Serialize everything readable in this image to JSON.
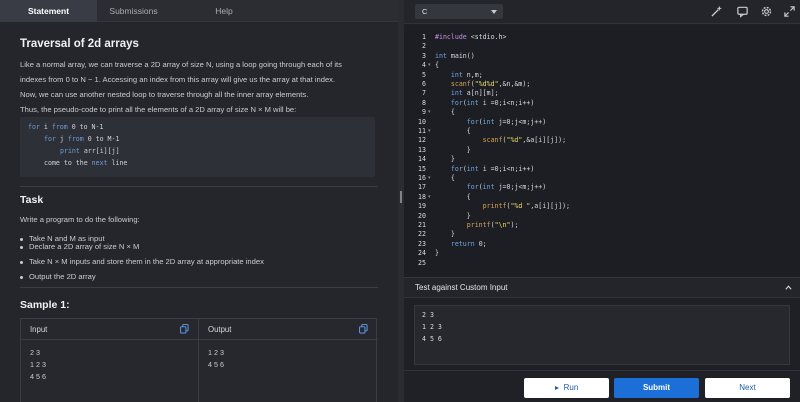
{
  "tabs": {
    "statement": "Statement",
    "submissions": "Submissions",
    "help": "Help"
  },
  "problem": {
    "title": "Traversal of 2d arrays",
    "intro_lines": [
      "Like a normal array, we can traverse a 2D array of size N, using a loop going through each of its",
      "indexes from 0 to N − 1. Accessing an index from this array will give us the array at that index.",
      "Now, we can use another nested loop to traverse through all the inner array elements.",
      "Thus, the pseudo-code to print all the elements of a 2D array of size N × M will be:"
    ],
    "pseudo_code": [
      {
        "kw1": "for",
        "rest1": " i ",
        "kw2": "from",
        "rest2": " 0 to N-1"
      },
      {
        "kw1": "for",
        "rest1": " j ",
        "kw2": "from",
        "rest2": " 0 to M-1"
      },
      {
        "kw1": "print",
        "rest1": " arr[i][j]",
        "kw2": "",
        "rest2": ""
      },
      {
        "kw1": "",
        "rest1": "come to the ",
        "kw2": "next",
        "rest2": " line"
      }
    ],
    "task_heading": "Task",
    "task_intro": "Write a program to do the following:",
    "task_items": [
      "Take N and M as input",
      "Declare a 2D array of size N × M",
      "Take N × M inputs and store them in the 2D array at appropriate index",
      "Output the 2D array"
    ],
    "sample_heading": "Sample 1:",
    "sample": {
      "input_label": "Input",
      "output_label": "Output",
      "input_lines": [
        "2 3",
        "1 2 3",
        "4 5 6"
      ],
      "output_lines": [
        "1 2 3",
        "4 5 6"
      ]
    }
  },
  "editor": {
    "language": "C",
    "icons": [
      "magic-wand-icon",
      "comment-icon",
      "gear-icon",
      "expand-icon"
    ],
    "line_numbers": [
      "1",
      "2",
      "3",
      "4",
      "5",
      "6",
      "7",
      "8",
      "9",
      "10",
      "11",
      "12",
      "13",
      "14",
      "15",
      "16",
      "17",
      "18",
      "19",
      "20",
      "21",
      "22",
      "23",
      "24",
      "25"
    ],
    "code_lines": [
      "#include <stdio.h>",
      "",
      "int main()",
      "{",
      "    int n,m;",
      "    scanf(\"%d%d\",&n,&m);",
      "    int a[n][m];",
      "    for(int i =0;i<n;i++)",
      "    {",
      "        for(int j=0;j<m;j++)",
      "        {",
      "            scanf(\"%d\",&a[i][j]);",
      "        }",
      "    }",
      "    for(int i =0;i<n;i++)",
      "    {",
      "        for(int j=0;j<m;j++)",
      "        {",
      "            printf(\"%d \",a[i][j]);",
      "        }",
      "        printf(\"\\n\");",
      "    }",
      "    return 0;",
      "}",
      ""
    ]
  },
  "custom_input": {
    "label": "Test against Custom Input",
    "lines": [
      "2 3",
      "1 2 3",
      "4 5 6"
    ]
  },
  "buttons": {
    "run": "Run",
    "submit": "Submit",
    "next": "Next"
  },
  "colors": {
    "accent": "#1c6fd6",
    "background": "#1f2127"
  }
}
